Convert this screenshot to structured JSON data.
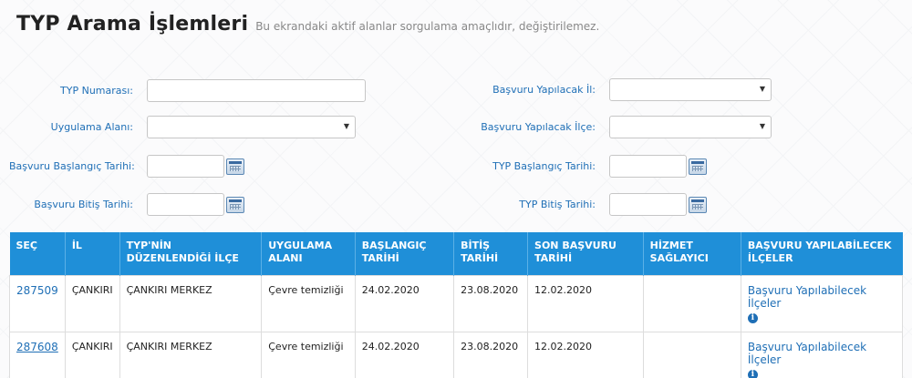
{
  "header": {
    "title": "TYP Arama İşlemleri",
    "subtitle": "Bu ekrandaki aktif alanlar sorgulama amaçlıdır, değiştirilemez."
  },
  "form": {
    "typ_numarasi": {
      "label": "TYP Numarası:",
      "value": ""
    },
    "uygulama_alani": {
      "label": "Uygulama Alanı:",
      "value": ""
    },
    "basvuru_baslangic": {
      "label": "Başvuru Başlangıç Tarihi:",
      "value": ""
    },
    "basvuru_bitis": {
      "label": "Başvuru Bitiş Tarihi:",
      "value": ""
    },
    "basvuru_il": {
      "label": "Başvuru Yapılacak İl:",
      "value": ""
    },
    "basvuru_ilce": {
      "label": "Başvuru Yapılacak İlçe:",
      "value": ""
    },
    "typ_baslangic": {
      "label": "TYP Başlangıç Tarihi:",
      "value": ""
    },
    "typ_bitis": {
      "label": "TYP Bitiş Tarihi:",
      "value": ""
    }
  },
  "table": {
    "headers": [
      "SEÇ",
      "İL",
      "TYP'NİN DÜZENLENDİĞİ İLÇE",
      "UYGULAMA ALANI",
      "BAŞLANGIÇ TARİHİ",
      "BİTİŞ TARİHİ",
      "SON BAŞVURU TARİHİ",
      "HİZMET SAĞLAYICI",
      "BAŞVURU YAPILABİLECEK İLÇELER"
    ],
    "rows": [
      {
        "code": "287509",
        "il": "ÇANKIRI",
        "ilce": "ÇANKIRI MERKEZ",
        "alan": "Çevre temizliği",
        "baslangic": "24.02.2020",
        "bitis": "23.08.2020",
        "son_basvuru": "12.02.2020",
        "hizmet": "",
        "ilceler_link": "Başvuru Yapılabilecek İlçeler"
      },
      {
        "code": "287608",
        "il": "ÇANKIRI",
        "ilce": "ÇANKIRI MERKEZ",
        "alan": "Çevre temizliği",
        "baslangic": "24.02.2020",
        "bitis": "23.08.2020",
        "son_basvuru": "12.02.2020",
        "hizmet": "",
        "ilceler_link": "Başvuru Yapılabilecek İlçeler"
      }
    ]
  },
  "icons": {
    "calendar": "calendar-icon",
    "dropdown": "chevron-down-icon",
    "info": "info-icon"
  }
}
